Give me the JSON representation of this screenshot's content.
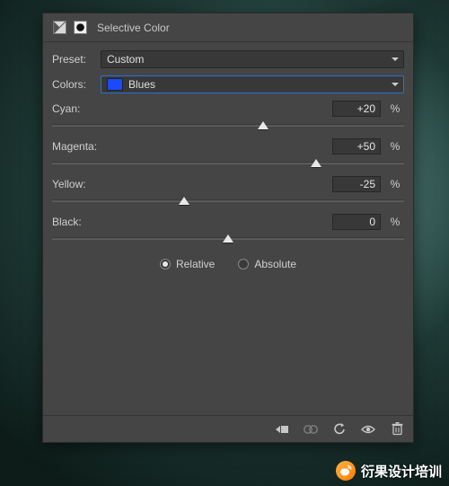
{
  "panel": {
    "title": "Selective Color",
    "presetLabel": "Preset:",
    "presetValue": "Custom",
    "colorsLabel": "Colors:",
    "colorsValue": "Blues",
    "swatchColor": "#1a49ff"
  },
  "sliders": [
    {
      "name": "Cyan:",
      "value": "+20",
      "pct": "%",
      "pos": 60
    },
    {
      "name": "Magenta:",
      "value": "+50",
      "pct": "%",
      "pos": 75
    },
    {
      "name": "Yellow:",
      "value": "-25",
      "pct": "%",
      "pos": 37.5
    },
    {
      "name": "Black:",
      "value": "0",
      "pct": "%",
      "pos": 50
    }
  ],
  "radios": {
    "relative": "Relative",
    "absolute": "Absolute",
    "selected": "relative"
  },
  "watermark": "衍果设计培训"
}
